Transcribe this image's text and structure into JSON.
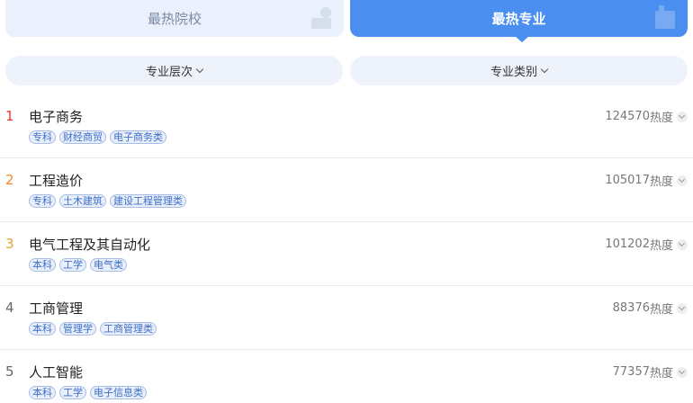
{
  "tabs": {
    "hot_schools": "最热院校",
    "hot_majors": "最热专业"
  },
  "filters": {
    "level": "专业层次",
    "category": "专业类别"
  },
  "heat_suffix": "热度",
  "majors": [
    {
      "rank": "1",
      "name": "电子商务",
      "tags": [
        "专科",
        "财经商贸",
        "电子商务类"
      ],
      "heat": "124570"
    },
    {
      "rank": "2",
      "name": "工程造价",
      "tags": [
        "专科",
        "土木建筑",
        "建设工程管理类"
      ],
      "heat": "105017"
    },
    {
      "rank": "3",
      "name": "电气工程及其自动化",
      "tags": [
        "本科",
        "工学",
        "电气类"
      ],
      "heat": "101202"
    },
    {
      "rank": "4",
      "name": "工商管理",
      "tags": [
        "本科",
        "管理学",
        "工商管理类"
      ],
      "heat": "88376"
    },
    {
      "rank": "5",
      "name": "人工智能",
      "tags": [
        "本科",
        "工学",
        "电子信息类"
      ],
      "heat": "77357"
    }
  ],
  "colors": {
    "accent": "#4a8ef0",
    "rank1": "#e53935",
    "rank2": "#ef8a1c",
    "rank3": "#e6a32a"
  }
}
